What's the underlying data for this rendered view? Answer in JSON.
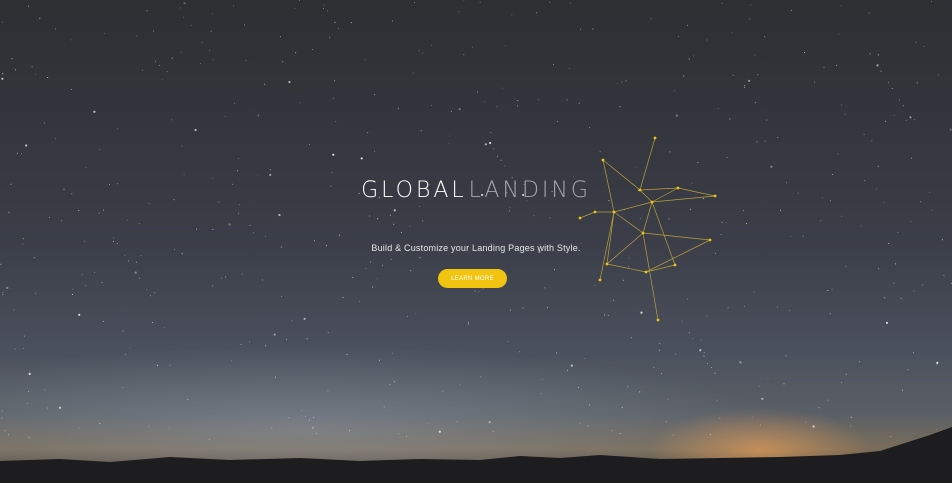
{
  "hero": {
    "title_bold": "GLOBAL",
    "title_light": "LANDING",
    "subtitle": "Build & Customize your Landing Pages with Style.",
    "cta_label": "LEARN MORE"
  },
  "colors": {
    "accent": "#f1c40f",
    "network_line": "#d9b83a"
  }
}
